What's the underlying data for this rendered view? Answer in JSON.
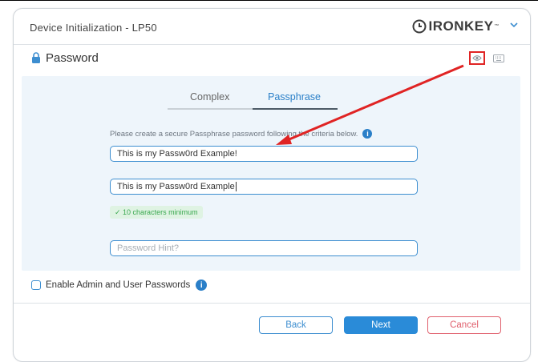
{
  "window": {
    "title": "Device Initialization - LP50",
    "logo_text": "IRONKEY",
    "logo_tm": "™"
  },
  "section": {
    "title": "Password",
    "icons": [
      "lock-icon",
      "eye-icon",
      "keyboard-icon"
    ]
  },
  "tabs": [
    {
      "label": "Complex",
      "active": false
    },
    {
      "label": "Passphrase",
      "active": true
    }
  ],
  "instructions": "Please create a secure Passphrase password following the criteria below.",
  "fields": {
    "password_value": "This is my Passw0rd Example!",
    "confirm_value": "This is my Passw0rd Example",
    "hint_placeholder": "Password Hint?"
  },
  "criteria": "✓ 10 characters minimum",
  "admin_option": {
    "label": "Enable Admin and User Passwords",
    "checked": false
  },
  "buttons": {
    "back": "Back",
    "next": "Next",
    "cancel": "Cancel"
  },
  "colors": {
    "accent": "#2a8bd8",
    "cancel": "#e0606d",
    "annotation": "#e02424",
    "success": "#39a84f"
  }
}
